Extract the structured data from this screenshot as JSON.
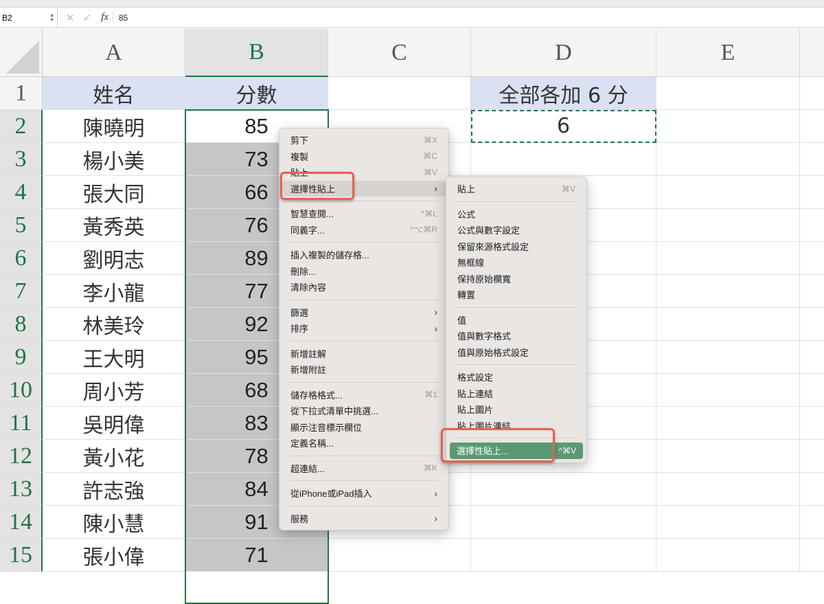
{
  "formula_bar": {
    "name_box": "B2",
    "formula_value": "85",
    "cancel_icon": "✕",
    "enter_icon": "✓",
    "fx_label": "fx"
  },
  "columns": [
    "A",
    "B",
    "C",
    "D",
    "E"
  ],
  "rows": [
    {
      "n": "1",
      "a": "姓名",
      "b": "分數",
      "d": "全部各加 6 分"
    },
    {
      "n": "2",
      "a": "陳曉明",
      "b": "85",
      "d": "6"
    },
    {
      "n": "3",
      "a": "楊小美",
      "b": "73"
    },
    {
      "n": "4",
      "a": "張大同",
      "b": "66"
    },
    {
      "n": "5",
      "a": "黃秀英",
      "b": "76"
    },
    {
      "n": "6",
      "a": "劉明志",
      "b": "89"
    },
    {
      "n": "7",
      "a": "李小龍",
      "b": "77"
    },
    {
      "n": "8",
      "a": "林美玲",
      "b": "92"
    },
    {
      "n": "9",
      "a": "王大明",
      "b": "95"
    },
    {
      "n": "10",
      "a": "周小芳",
      "b": "68"
    },
    {
      "n": "11",
      "a": "吳明偉",
      "b": "83"
    },
    {
      "n": "12",
      "a": "黃小花",
      "b": "78"
    },
    {
      "n": "13",
      "a": "許志強",
      "b": "84"
    },
    {
      "n": "14",
      "a": "陳小慧",
      "b": "91"
    },
    {
      "n": "15",
      "a": "張小偉",
      "b": "71"
    }
  ],
  "context_menu": [
    {
      "label": "剪下",
      "shortcut": "⌘X"
    },
    {
      "label": "複製",
      "shortcut": "⌘C"
    },
    {
      "label": "貼上",
      "shortcut": "⌘V"
    },
    {
      "label": "選擇性貼上",
      "submenu": true,
      "highlighted": true
    },
    {
      "sep": true
    },
    {
      "label": "智慧查閱...",
      "shortcut": "^⌘L"
    },
    {
      "label": "同義字...",
      "shortcut": "^⌥⌘R"
    },
    {
      "sep": true
    },
    {
      "label": "插入複製的儲存格..."
    },
    {
      "label": "刪除..."
    },
    {
      "label": "清除內容"
    },
    {
      "sep": true
    },
    {
      "label": "篩選",
      "submenu": true
    },
    {
      "label": "排序",
      "submenu": true
    },
    {
      "sep": true
    },
    {
      "label": "新增註解"
    },
    {
      "label": "新增附註"
    },
    {
      "sep": true
    },
    {
      "label": "儲存格格式...",
      "shortcut": "⌘1"
    },
    {
      "label": "從下拉式清單中挑選..."
    },
    {
      "label": "顯示注音標示欄位"
    },
    {
      "label": "定義名稱..."
    },
    {
      "sep": true
    },
    {
      "label": "超連結...",
      "shortcut": "⌘K"
    },
    {
      "sep": true
    },
    {
      "label": "從iPhone或iPad插入",
      "submenu": true
    },
    {
      "sep": true
    },
    {
      "label": "服務",
      "submenu": true
    }
  ],
  "paste_special_submenu": [
    {
      "label": "貼上",
      "shortcut": "⌘V"
    },
    {
      "sep": true
    },
    {
      "label": "公式"
    },
    {
      "label": "公式與數字設定"
    },
    {
      "label": "保留來源格式設定"
    },
    {
      "label": "無框線"
    },
    {
      "label": "保持原始欄寬"
    },
    {
      "label": "轉置"
    },
    {
      "sep": true
    },
    {
      "label": "值"
    },
    {
      "label": "值與數字格式"
    },
    {
      "label": "值與原始格式設定"
    },
    {
      "sep": true
    },
    {
      "label": "格式設定"
    },
    {
      "label": "貼上連結"
    },
    {
      "label": "貼上圖片"
    },
    {
      "label": "貼上圖片連結"
    },
    {
      "sep": true
    },
    {
      "label": "選擇性貼上...",
      "shortcut": "^⌘V",
      "active": true
    }
  ],
  "colors": {
    "accent": "#217346",
    "header_fill": "#d9e1f2",
    "menu_active": "#5a9a72",
    "callout": "#e8604f"
  }
}
